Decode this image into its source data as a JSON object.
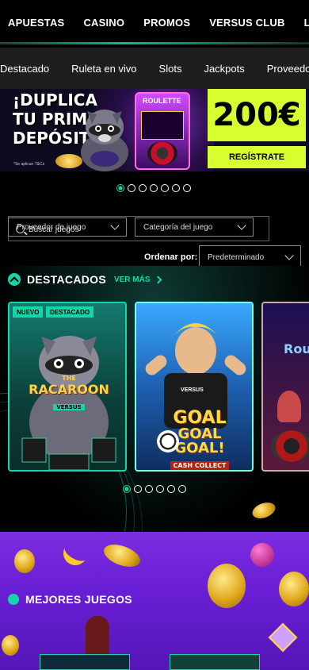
{
  "top_nav": {
    "items": [
      "APUESTAS",
      "CASINO",
      "PROMOS",
      "VERSUS CLUB",
      "LO"
    ]
  },
  "sub_nav": {
    "items": [
      "Destacado",
      "Ruleta en vivo",
      "Slots",
      "Jackpots",
      "Proveedores"
    ]
  },
  "banner": {
    "headline_1": "¡DUPLICA",
    "headline_2": "TU PRIMER",
    "headline_3": "DEPÓSITO!",
    "terms": "*Se aplican T&Cs",
    "machine_tag": "ROULETTE",
    "amount": "200€",
    "cta": "REGÍSTRATE",
    "slides": 7,
    "active_slide": 0
  },
  "filters": {
    "provider_label": "Proveedor de juego",
    "search_placeholder": "Buscar juegos",
    "category_label": "Categoría del juego",
    "sort_label": "Ordenar por:",
    "sort_value": "Predeterminado"
  },
  "featured": {
    "title": "DESTACADOS",
    "see_more": "VER MÁS",
    "games": [
      {
        "badges": [
          "NUEVO",
          "DESTACADO"
        ],
        "title_1": "THE",
        "title_2": "RACAROON",
        "title_3": "VERSUS"
      },
      {
        "badges": [],
        "title_1": "GOAL",
        "title_2": "GOAL",
        "title_3": "GOAL!",
        "subtitle": "CASH COLLECT",
        "jersey": "VERSUS"
      },
      {
        "badges": [],
        "title_1": "Rou"
      }
    ],
    "slides": 6,
    "active_slide": 0
  },
  "best_games": {
    "title": "MEJORES JUEGOS"
  },
  "colors": {
    "accent": "#14d6a8",
    "promo_yellow": "#d7ff2f",
    "purple": "#6a1fd6"
  }
}
